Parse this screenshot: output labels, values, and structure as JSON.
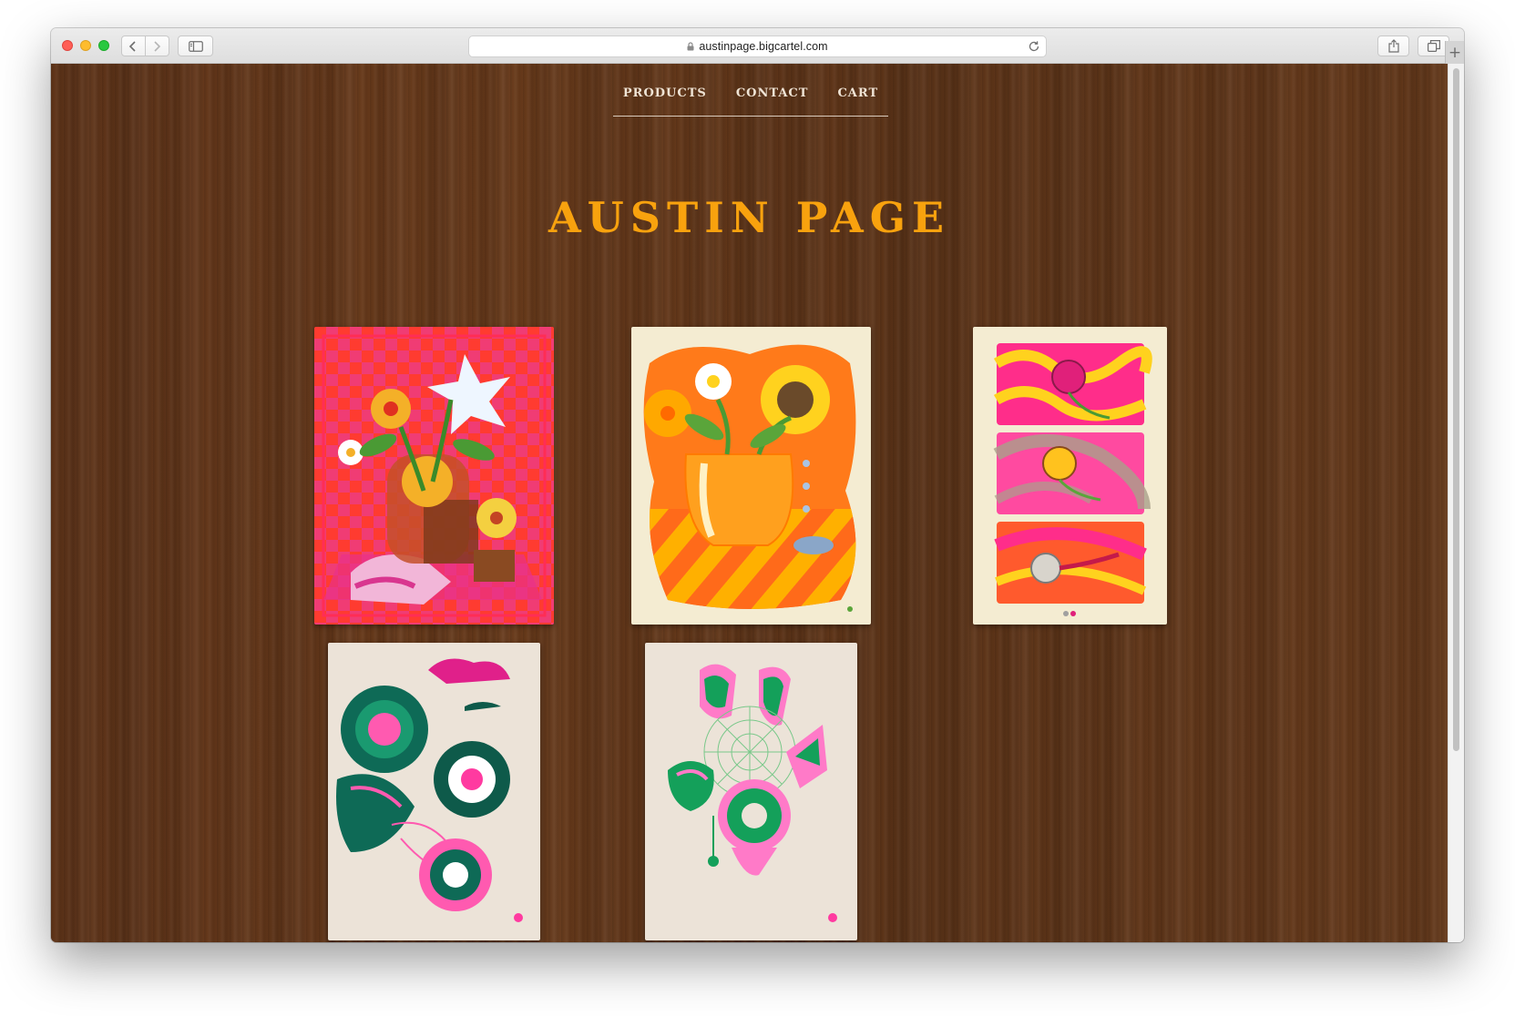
{
  "browser": {
    "url": "austinpage.bigcartel.com",
    "new_tab_symbol": "+",
    "icons": [
      "back-icon",
      "forward-icon",
      "sidebar-icon",
      "lock-icon",
      "reload-icon",
      "share-icon",
      "tabs-icon"
    ]
  },
  "site": {
    "nav": {
      "products": "PRODUCTS",
      "contact": "CONTACT",
      "cart": "CART"
    },
    "title": "AUSTIN PAGE",
    "colors": {
      "title": "#f8a20e",
      "nav_text": "#efe3d4",
      "background_wood": "#5e3518"
    }
  }
}
